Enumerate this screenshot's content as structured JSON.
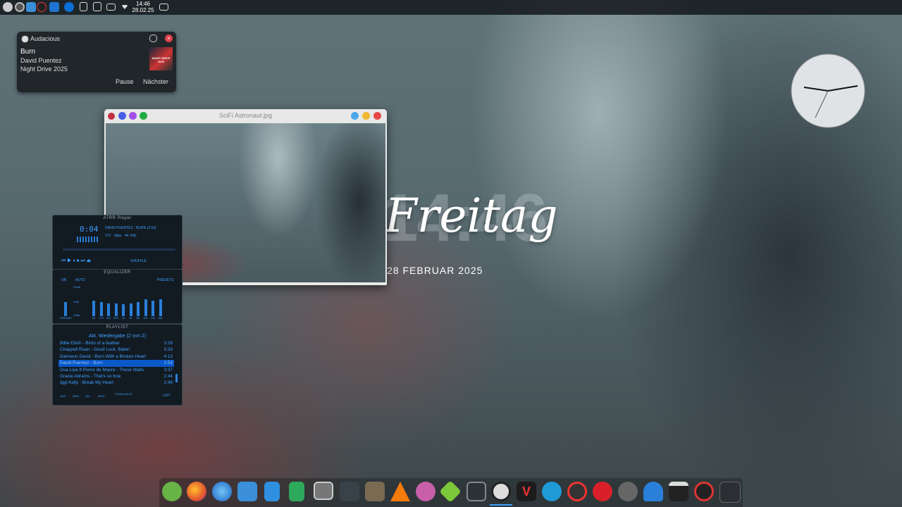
{
  "panel": {
    "time": "14:46",
    "date": "28.02.25"
  },
  "notification": {
    "app": "Audacious",
    "title": "Burn",
    "artist": "David Puentez",
    "album": "Night Drive 2025",
    "album_art_text": "NIGHT DRIVE 2025",
    "btn_pause": "Pause",
    "btn_next": "Nächster"
  },
  "viewer": {
    "title": "SciFi Astronaut.jpg"
  },
  "desktop": {
    "weekday": "Freitag",
    "big_time": "14:46",
    "date": "28 FEBRUAR 2025"
  },
  "player": {
    "title": "ATRR Player",
    "time": "0:04",
    "marquee": "DAVID PUENTEZ - BURN (2:53)",
    "kbps": "172",
    "khz": "44",
    "kbps_label": "kbps",
    "khz_label": "kHz",
    "shuffle": "SHUFFLE",
    "eq_title": "EQUALIZER",
    "eq_on": "ON",
    "eq_auto": "AUTO",
    "eq_presets": "PRESETS",
    "eq_db_top": "+20db",
    "eq_db_mid": "+0db",
    "eq_db_bot": "-20db",
    "eq_preamp": "PREAMP",
    "eq_bands": [
      "60",
      "170",
      "310",
      "600",
      "1K",
      "3K",
      "6K",
      "12K",
      "14K",
      "16K"
    ],
    "eq_levels": [
      0.55,
      0.5,
      0.45,
      0.45,
      0.42,
      0.45,
      0.5,
      0.6,
      0.55,
      0.6
    ],
    "pl_title": "PLAYLIST",
    "pl_header": "Akt. Wiedergabe (2 von 2)",
    "playlist": [
      {
        "t": "Billie Eilish - Birds of a feather",
        "d": "3:29"
      },
      {
        "t": "Chappell Roan - Good Luck, Babe!",
        "d": "3:33"
      },
      {
        "t": "Damiano David - Born With a Broken Heart",
        "d": "4:13"
      },
      {
        "t": "David Puentez - Burn",
        "d": "2:53"
      },
      {
        "t": "Dua Lipa ft Pierre de Maere - These Walls",
        "d": "3:37"
      },
      {
        "t": "Gracie Abrams - That's so true",
        "d": "2:44"
      },
      {
        "t": "Iggi Kelly - Break My Heart",
        "d": "2:49"
      }
    ],
    "selected_index": 3,
    "pl_buttons": [
      "ADD",
      "REM",
      "SEL",
      "MISC"
    ],
    "pl_total": "2:53/24:56:23",
    "pl_list": "LIST"
  }
}
